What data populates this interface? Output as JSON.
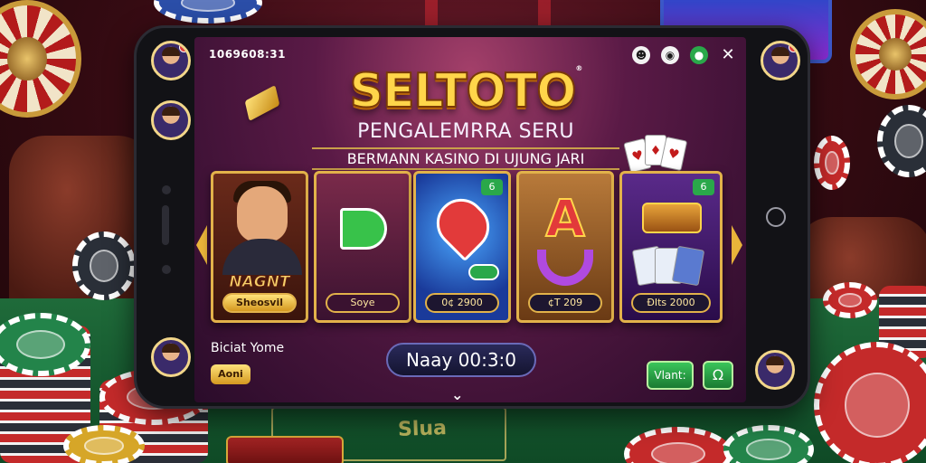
{
  "app": {
    "logo": "SELTOTO",
    "logo_mark": "®",
    "tagline": "PENGALEMRRA SERU",
    "subtagline": "BERMANN KASINO DI UJUNG JARI"
  },
  "status_bar": {
    "text": "1069608:31"
  },
  "top_icons": [
    {
      "name": "emoji-icon",
      "glyph": "☻"
    },
    {
      "name": "chat-icon",
      "glyph": "◉"
    },
    {
      "name": "green-settings-icon",
      "glyph": "●"
    },
    {
      "name": "close-icon",
      "glyph": "✕"
    }
  ],
  "games": [
    {
      "title": "NAGNT",
      "pill": "Sheosvil"
    },
    {
      "title": "",
      "pill": "Soye"
    },
    {
      "title": "",
      "pill": "0¢ 2900",
      "badge": "6"
    },
    {
      "title": "",
      "pill": "¢T 209"
    },
    {
      "title": "",
      "pill": "ĐIts 2000",
      "badge": "6"
    }
  ],
  "bottom": {
    "left_label": "Biciat Yome",
    "left_button": "Aoni",
    "timer": "Naay 00:3:0",
    "right_button": "Vlant:",
    "right_icon_glyph": "Ω"
  },
  "table_text": "Slua",
  "colors": {
    "accent_gold": "#e2b24a",
    "logo_gold": "#ffd54a",
    "button_green": "#2aa84a",
    "screen_bg": "#5a1a46"
  }
}
